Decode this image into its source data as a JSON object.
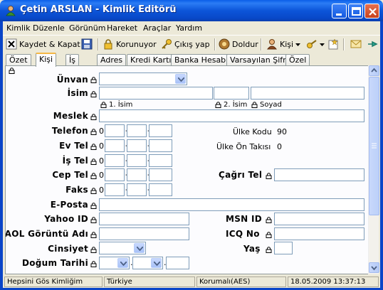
{
  "window": {
    "title": "Çetin ARSLAN - Kimlik Editörü"
  },
  "menu": [
    "Kimlik",
    "Düzenle",
    "Görünüm",
    "Hareket",
    "Araçlar",
    "Yardım"
  ],
  "toolbar": {
    "save_close": "Kaydet & Kapat",
    "protected": "Korunuyor",
    "logout": "Çıkış yap",
    "fill": "Doldur",
    "person": "Kişi"
  },
  "tabs": [
    "Özet",
    "Kişi",
    "İş",
    "Adres",
    "Kredi Kartı",
    "Banka Hesabı",
    "Varsayılan Şifre",
    "Özel"
  ],
  "active_tab": "Kişi",
  "form": {
    "title_label": "Ünvan",
    "name_label": "İsim",
    "name_sub1": "1. İsim",
    "name_sub2": "2. İsim",
    "name_sub3": "Soyad",
    "job_label": "Meslek",
    "phone_label": "Telefon",
    "phone_prefix": "0",
    "country_code_label": "Ülke Kodu",
    "country_code_value": "90",
    "home_phone_label": "Ev Tel",
    "home_phone_prefix": "0",
    "country_prefix_label": "Ülke Ön Takısı",
    "country_prefix_value": "0",
    "work_phone_label": "İş Tel",
    "work_phone_prefix": "0",
    "mobile_label": "Cep Tel",
    "mobile_prefix": "0",
    "pager_label": "Çağrı Tel",
    "fax_label": "Faks",
    "fax_prefix": "0",
    "email_label": "E-Posta",
    "yahoo_label": "Yahoo ID",
    "msn_label": "MSN ID",
    "aol_label": "AOL Görüntü Adı",
    "icq_label": "ICQ No",
    "gender_label": "Cinsiyet",
    "age_label": "Yaş",
    "birth_label": "Doğum Tarihi"
  },
  "status": {
    "identity": "Hepsini Gös Kimliğim",
    "country": "Türkiye",
    "protection": "Korumalı(AES)",
    "datetime": "18.05.2009 13:37:13"
  }
}
